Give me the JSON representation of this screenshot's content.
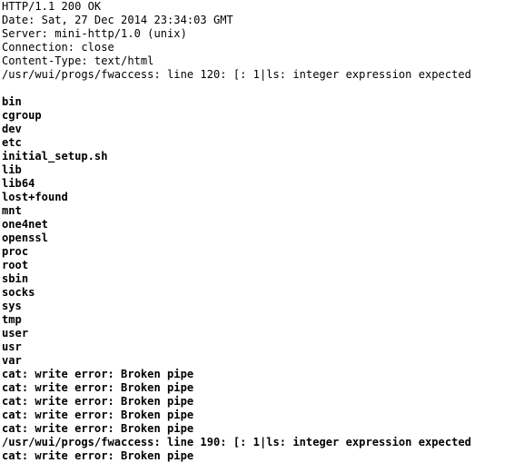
{
  "http_headers": [
    "HTTP/1.1 200 OK",
    "Date: Sat, 27 Dec 2014 23:34:03 GMT",
    "Server: mini-http/1.0 (unix)",
    "Connection: close",
    "Content-Type: text/html",
    "/usr/wui/progs/fwaccess: line 120: [: 1|ls: integer expression expected"
  ],
  "directory_listing": [
    "bin",
    "cgroup",
    "dev",
    "etc",
    "initial_setup.sh",
    "lib",
    "lib64",
    "lost+found",
    "mnt",
    "one4net",
    "openssl",
    "proc",
    "root",
    "sbin",
    "socks",
    "sys",
    "tmp",
    "user",
    "usr",
    "var"
  ],
  "error_output": [
    "cat: write error: Broken pipe",
    "cat: write error: Broken pipe",
    "cat: write error: Broken pipe",
    "cat: write error: Broken pipe",
    "cat: write error: Broken pipe",
    "/usr/wui/progs/fwaccess: line 190: [: 1|ls: integer expression expected",
    "cat: write error: Broken pipe"
  ]
}
